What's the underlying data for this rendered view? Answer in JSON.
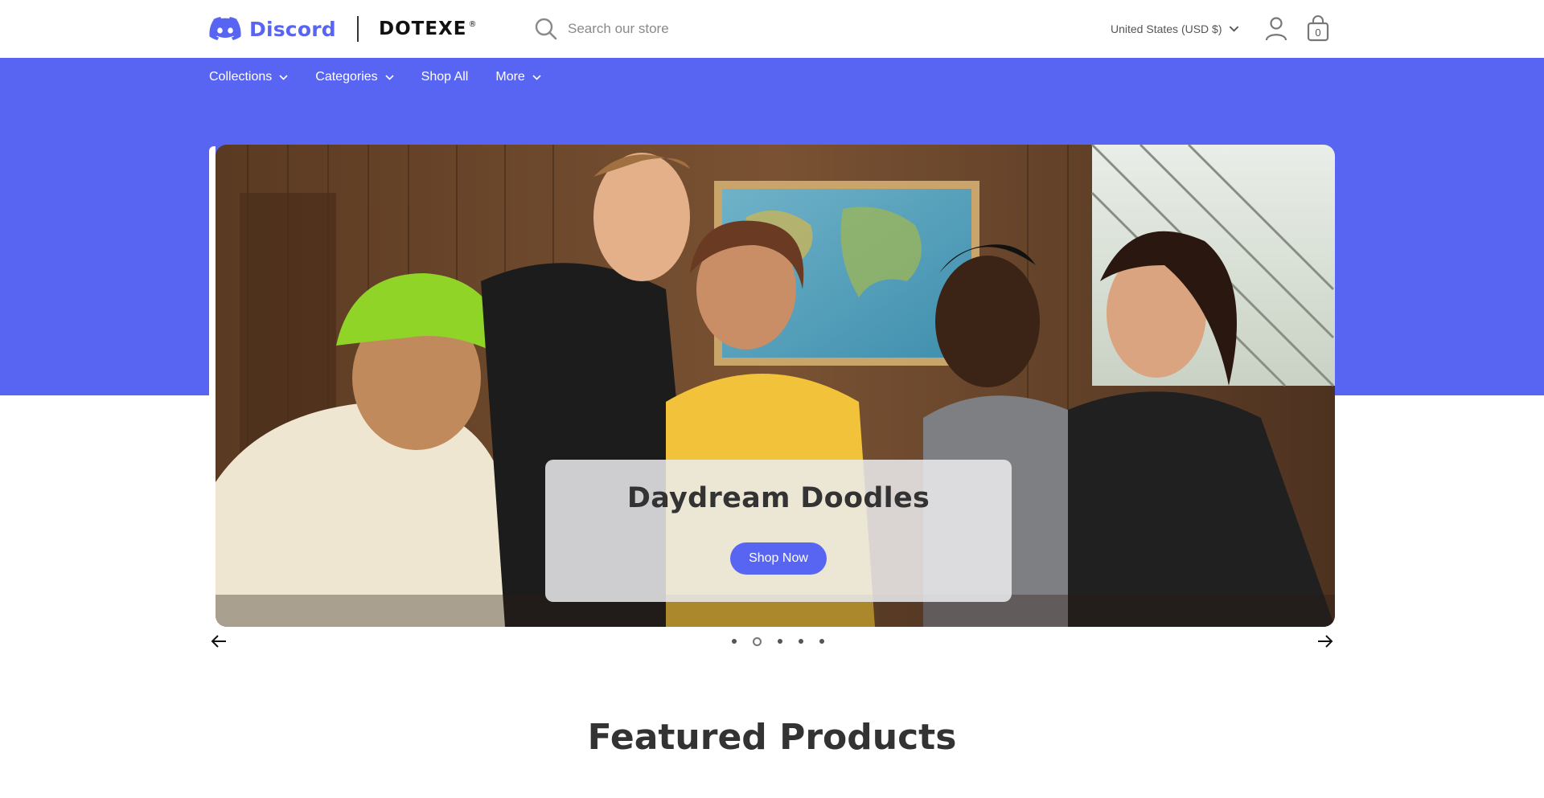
{
  "brand": {
    "discord_logo_text": "Discord",
    "partner_logo_text": "DOTEXE",
    "partner_registered_mark": "®",
    "accent_color": "#5865f2"
  },
  "search": {
    "placeholder": "Search our store"
  },
  "currency": {
    "label": "United States (USD $)"
  },
  "cart": {
    "count": "0"
  },
  "nav": {
    "items": [
      {
        "label": "Collections",
        "has_dropdown": true
      },
      {
        "label": "Categories",
        "has_dropdown": true
      },
      {
        "label": "Shop All",
        "has_dropdown": false
      },
      {
        "label": "More",
        "has_dropdown": true
      }
    ]
  },
  "hero": {
    "title": "Daydream Doodles",
    "cta_label": "Shop Now",
    "image_description_icon": "group-photo",
    "slide_count": 5,
    "active_slide": 2
  },
  "featured": {
    "title": "Featured Products"
  },
  "icons": {
    "search": "search-icon",
    "account": "account-icon",
    "cart": "shopping-bag-icon",
    "prev": "arrow-left-icon",
    "next": "arrow-right-icon",
    "dropdown": "chevron-down-icon"
  }
}
